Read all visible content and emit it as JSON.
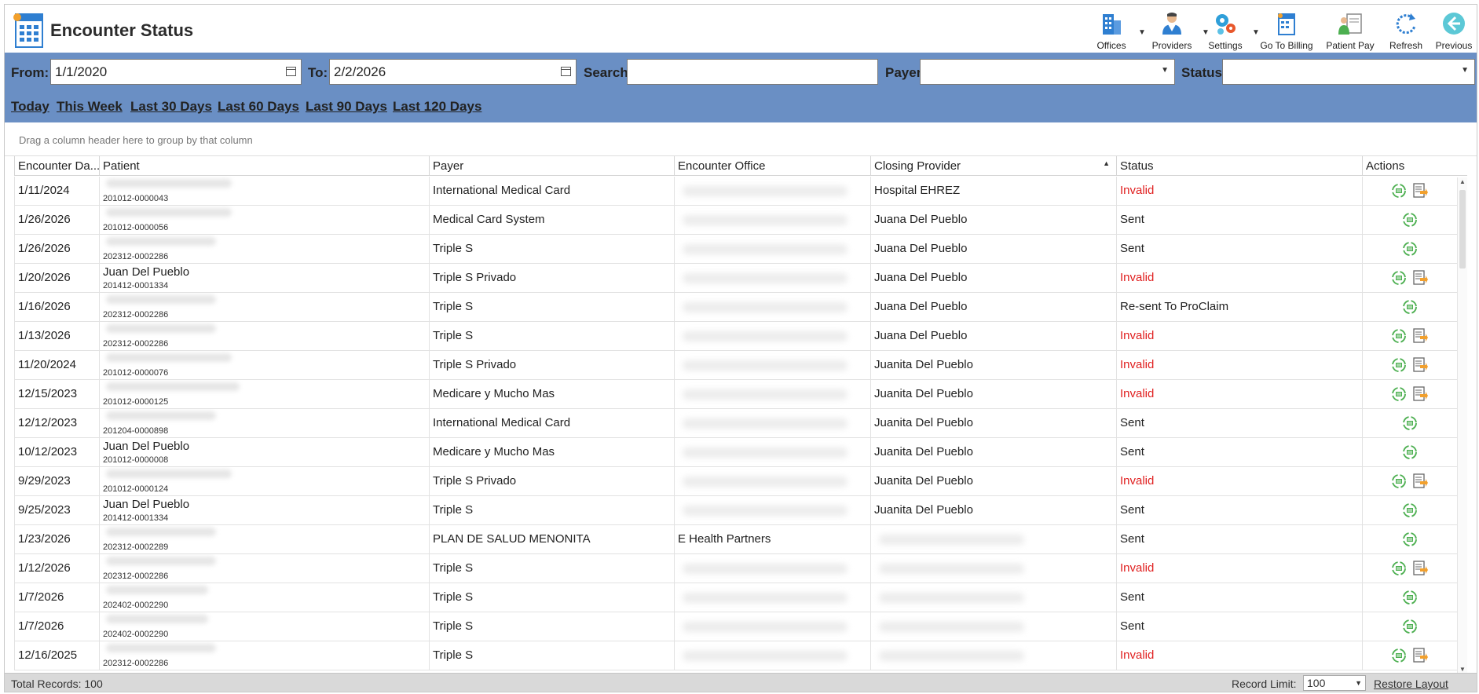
{
  "window": {
    "title": "Encounter Status"
  },
  "toolbar": [
    {
      "label": "Offices",
      "icon": "offices-icon",
      "has_dropdown": true
    },
    {
      "label": "Providers",
      "icon": "providers-icon",
      "has_dropdown": true
    },
    {
      "label": "Settings",
      "icon": "settings-icon",
      "has_dropdown": true
    },
    {
      "label": "Go To Billing",
      "icon": "billing-icon",
      "has_dropdown": false
    },
    {
      "label": "Patient Pay",
      "icon": "patient-pay-icon",
      "has_dropdown": false
    },
    {
      "label": "Refresh",
      "icon": "refresh-icon",
      "has_dropdown": false
    },
    {
      "label": "Previous",
      "icon": "previous-icon",
      "has_dropdown": false
    }
  ],
  "filters": {
    "from_label": "From:",
    "from_value": "1/1/2020",
    "to_label": "To:",
    "to_value": "2/2/2026",
    "search_label": "Search:",
    "search_value": "",
    "payer_label": "Payer:",
    "payer_value": "",
    "status_label": "Status:",
    "status_value": ""
  },
  "quick_ranges": [
    "Today",
    "This Week",
    "Last 30 Days",
    "Last 60 Days",
    "Last 90 Days",
    "Last 120 Days"
  ],
  "group_panel_hint": "Drag a column header here to group by that column",
  "columns": [
    "Encounter Da...",
    "Patient",
    "Payer",
    "Encounter Office",
    "Closing Provider",
    "Status",
    "Actions"
  ],
  "rows": [
    {
      "date": "1/11/2024",
      "patient_name": "",
      "patient_id": "201012-0000043",
      "payer": "International Medical Card",
      "office": "",
      "provider": "Hospital EHREZ",
      "status": "Invalid",
      "invalid": true,
      "actions": [
        "view",
        "edit"
      ]
    },
    {
      "date": "1/26/2026",
      "patient_name": "",
      "patient_id": "201012-0000056",
      "payer": "Medical Card System",
      "office": "",
      "provider": "Juana Del Pueblo",
      "status": "Sent",
      "invalid": false,
      "actions": [
        "view"
      ]
    },
    {
      "date": "1/26/2026",
      "patient_name": "",
      "patient_id": "202312-0002286",
      "payer": "Triple S",
      "office": "",
      "provider": "Juana Del Pueblo",
      "status": "Sent",
      "invalid": false,
      "actions": [
        "view"
      ]
    },
    {
      "date": "1/20/2026",
      "patient_name": "Juan Del Pueblo",
      "patient_id": "201412-0001334",
      "payer": "Triple S Privado",
      "office": "",
      "provider": "Juana Del Pueblo",
      "status": "Invalid",
      "invalid": true,
      "actions": [
        "view",
        "edit"
      ]
    },
    {
      "date": "1/16/2026",
      "patient_name": "",
      "patient_id": "202312-0002286",
      "payer": "Triple S",
      "office": "",
      "provider": "Juana Del Pueblo",
      "status": "Re-sent To ProClaim",
      "invalid": false,
      "actions": [
        "view"
      ]
    },
    {
      "date": "1/13/2026",
      "patient_name": "",
      "patient_id": "202312-0002286",
      "payer": "Triple S",
      "office": "",
      "provider": "Juana Del Pueblo",
      "status": "Invalid",
      "invalid": true,
      "actions": [
        "view",
        "edit"
      ]
    },
    {
      "date": "11/20/2024",
      "patient_name": "",
      "patient_id": "201012-0000076",
      "payer": "Triple S Privado",
      "office": "",
      "provider": "Juanita Del Pueblo",
      "status": "Invalid",
      "invalid": true,
      "actions": [
        "view",
        "edit"
      ]
    },
    {
      "date": "12/15/2023",
      "patient_name": "",
      "patient_id": "201012-0000125",
      "payer": "Medicare y Mucho Mas",
      "office": "",
      "provider": "Juanita Del Pueblo",
      "status": "Invalid",
      "invalid": true,
      "actions": [
        "view",
        "edit"
      ]
    },
    {
      "date": "12/12/2023",
      "patient_name": "",
      "patient_id": "201204-0000898",
      "payer": "International Medical Card",
      "office": "",
      "provider": "Juanita Del Pueblo",
      "status": "Sent",
      "invalid": false,
      "actions": [
        "view"
      ]
    },
    {
      "date": "10/12/2023",
      "patient_name": "Juan Del Pueblo",
      "patient_id": "201012-0000008",
      "payer": "Medicare y Mucho Mas",
      "office": "",
      "provider": "Juanita Del Pueblo",
      "status": "Sent",
      "invalid": false,
      "actions": [
        "view"
      ]
    },
    {
      "date": "9/29/2023",
      "patient_name": "",
      "patient_id": "201012-0000124",
      "payer": "Triple S Privado",
      "office": "",
      "provider": "Juanita Del Pueblo",
      "status": "Invalid",
      "invalid": true,
      "actions": [
        "view",
        "edit"
      ]
    },
    {
      "date": "9/25/2023",
      "patient_name": "Juan Del Pueblo",
      "patient_id": "201412-0001334",
      "payer": "Triple S",
      "office": "",
      "provider": "Juanita Del Pueblo",
      "status": "Sent",
      "invalid": false,
      "actions": [
        "view"
      ]
    },
    {
      "date": "1/23/2026",
      "patient_name": "",
      "patient_id": "202312-0002289",
      "payer": "PLAN DE SALUD MENONITA",
      "office": "E Health Partners",
      "provider": "",
      "status": "Sent",
      "invalid": false,
      "actions": [
        "view"
      ]
    },
    {
      "date": "1/12/2026",
      "patient_name": "",
      "patient_id": "202312-0002286",
      "payer": "Triple S",
      "office": "",
      "provider": "",
      "status": "Invalid",
      "invalid": true,
      "actions": [
        "view",
        "edit"
      ]
    },
    {
      "date": "1/7/2026",
      "patient_name": "",
      "patient_id": "202402-0002290",
      "payer": "Triple S",
      "office": "",
      "provider": "",
      "status": "Sent",
      "invalid": false,
      "actions": [
        "view"
      ]
    },
    {
      "date": "1/7/2026",
      "patient_name": "",
      "patient_id": "202402-0002290",
      "payer": "Triple S",
      "office": "",
      "provider": "",
      "status": "Sent",
      "invalid": false,
      "actions": [
        "view"
      ]
    },
    {
      "date": "12/16/2025",
      "patient_name": "",
      "patient_id": "202312-0002286",
      "payer": "Triple S",
      "office": "",
      "provider": "",
      "status": "Invalid",
      "invalid": true,
      "actions": [
        "view",
        "edit"
      ]
    }
  ],
  "footer": {
    "total_records": "Total Records: 100",
    "record_limit_label": "Record Limit:",
    "record_limit_value": "100",
    "restore_layout": "Restore Layout"
  },
  "colors": {
    "filter_bar": "#6a8fc4",
    "invalid": "#e02020",
    "action_green": "#4caf50",
    "footer": "#d9d9d9"
  }
}
